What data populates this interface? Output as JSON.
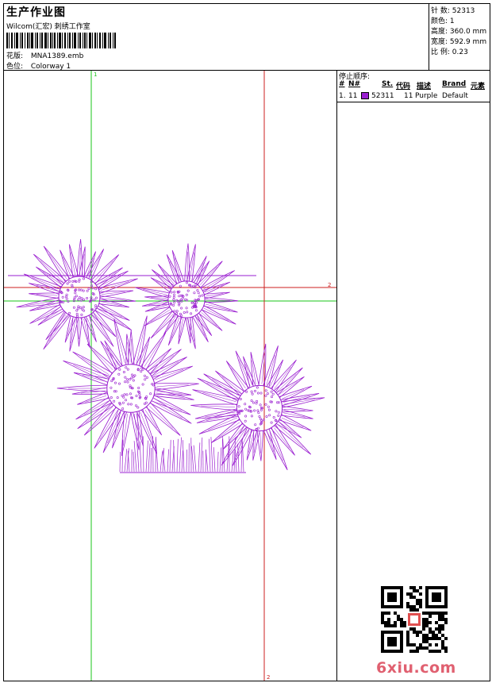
{
  "header": {
    "title": "生产作业图",
    "company": "Wilcom(汇宏) 刺绣工作室",
    "design_label": "花版:",
    "design_value": "MNA1389.emb",
    "colorway_label": "色位:",
    "colorway_value": "Colorway 1"
  },
  "stats": [
    {
      "label": "针 数:",
      "value": "52313"
    },
    {
      "label": "颜色:",
      "value": "1"
    },
    {
      "label": "高度:",
      "value": "360.0 mm"
    },
    {
      "label": "宽度:",
      "value": "592.9 mm"
    },
    {
      "label": "比 例:",
      "value": "0.23"
    }
  ],
  "stop_sequence": {
    "caption": "停止顺序:",
    "columns": [
      "#",
      "N#",
      "St.",
      "代码",
      "描述",
      "Brand",
      "元素"
    ],
    "rows": [
      {
        "index": "1.",
        "needle": "11",
        "stitches": "52311",
        "code": "11",
        "description": "Purple",
        "brand": "Default",
        "color": "#9a1fd0"
      }
    ]
  },
  "guides": {
    "marker_top": "1",
    "marker_right": "2",
    "marker_bottom": "2"
  },
  "colors": {
    "thread": "#9a1fd0",
    "guide_green": "#19c419",
    "guide_red": "#cc1f1f"
  },
  "watermark": "6xiu.com"
}
